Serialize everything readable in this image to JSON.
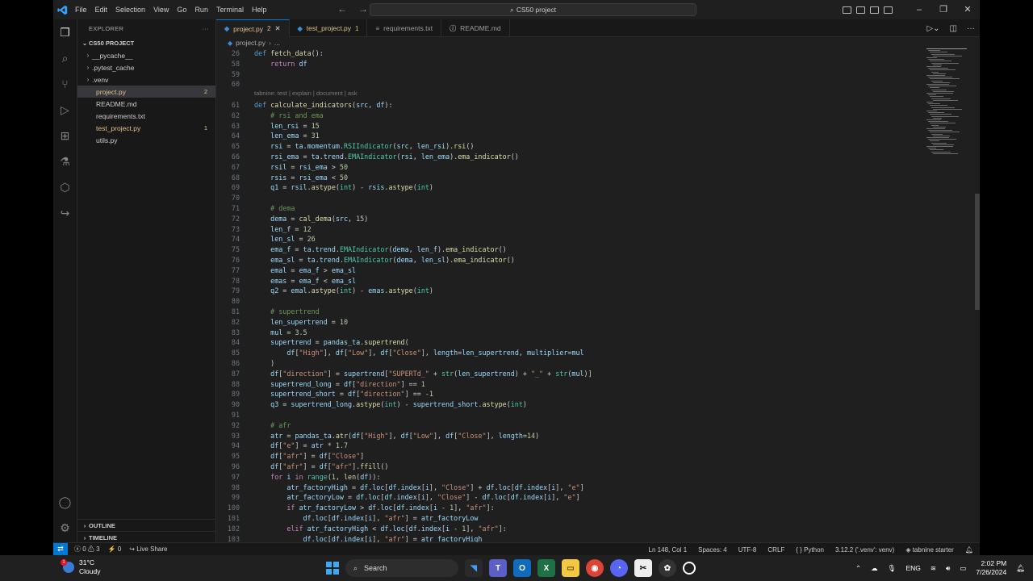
{
  "menu": [
    "File",
    "Edit",
    "Selection",
    "View",
    "Go",
    "Run",
    "Terminal",
    "Help"
  ],
  "search_title": "CS50 project",
  "explorer": {
    "header": "EXPLORER",
    "project": "CS50 PROJECT",
    "items": [
      {
        "label": "__pycache__",
        "folder": true
      },
      {
        "label": ".pytest_cache",
        "folder": true
      },
      {
        "label": ".venv",
        "folder": true
      },
      {
        "label": "project.py",
        "badge": "2",
        "selected": true
      },
      {
        "label": "README.md"
      },
      {
        "label": "requirements.txt"
      },
      {
        "label": "test_project.py",
        "badge": "1"
      },
      {
        "label": "utils.py"
      }
    ],
    "outline": "OUTLINE",
    "timeline": "TIMELINE"
  },
  "tabs": [
    {
      "label": "project.py",
      "mark": "2",
      "active": true
    },
    {
      "label": "test_project.py",
      "mark": "1"
    },
    {
      "label": "requirements.txt",
      "mark": ""
    },
    {
      "label": "README.md",
      "mark": ""
    }
  ],
  "breadcrumb": [
    "project.py",
    "..."
  ],
  "codelens": "tabnine: test | explain | document | ask",
  "code_lines": [
    {
      "n": "26",
      "html": "<span class=\"kw\">def</span> <span class=\"fn\">fetch_data</span>():"
    },
    {
      "n": "58",
      "html": "    <span class=\"cf\">return</span> <span class=\"vr\">df</span>"
    },
    {
      "n": "59",
      "html": ""
    },
    {
      "n": "60",
      "html": ""
    },
    {
      "n": "61",
      "html": "<span class=\"kw\">def</span> <span class=\"fn\">calculate_indicators</span>(<span class=\"pm\">src</span>, <span class=\"pm\">df</span>):"
    },
    {
      "n": "62",
      "html": "    <span class=\"cm\"># rsi and ema</span>"
    },
    {
      "n": "63",
      "html": "    <span class=\"vr\">len_rsi</span> = <span class=\"nm\">15</span>"
    },
    {
      "n": "64",
      "html": "    <span class=\"vr\">len_ema</span> = <span class=\"nm\">31</span>"
    },
    {
      "n": "65",
      "html": "    <span class=\"vr\">rsi</span> = <span class=\"vr\">ta</span>.<span class=\"vr\">momentum</span>.<span class=\"bi\">RSIIndicator</span>(<span class=\"vr\">src</span>, <span class=\"vr\">len_rsi</span>).<span class=\"fn\">rsi</span>()"
    },
    {
      "n": "66",
      "html": "    <span class=\"vr\">rsi_ema</span> = <span class=\"vr\">ta</span>.<span class=\"vr\">trend</span>.<span class=\"bi\">EMAIndicator</span>(<span class=\"vr\">rsi</span>, <span class=\"vr\">len_ema</span>).<span class=\"fn\">ema_indicator</span>()"
    },
    {
      "n": "67",
      "html": "    <span class=\"vr\">rsil</span> = <span class=\"vr\">rsi_ema</span> &gt; <span class=\"nm\">50</span>"
    },
    {
      "n": "68",
      "html": "    <span class=\"vr\">rsis</span> = <span class=\"vr\">rsi_ema</span> &lt; <span class=\"nm\">50</span>"
    },
    {
      "n": "69",
      "html": "    <span class=\"vr\">q1</span> = <span class=\"vr\">rsil</span>.<span class=\"fn\">astype</span>(<span class=\"bi\">int</span>) - <span class=\"vr\">rsis</span>.<span class=\"fn\">astype</span>(<span class=\"bi\">int</span>)"
    },
    {
      "n": "70",
      "html": ""
    },
    {
      "n": "71",
      "html": "    <span class=\"cm\"># dema</span>"
    },
    {
      "n": "72",
      "html": "    <span class=\"vr\">dema</span> = <span class=\"fn\">cal_dema</span>(<span class=\"vr\">src</span>, <span class=\"nm\">15</span>)"
    },
    {
      "n": "73",
      "html": "    <span class=\"vr\">len_f</span> = <span class=\"nm\">12</span>"
    },
    {
      "n": "74",
      "html": "    <span class=\"vr\">len_sl</span> = <span class=\"nm\">26</span>"
    },
    {
      "n": "75",
      "html": "    <span class=\"vr\">ema_f</span> = <span class=\"vr\">ta</span>.<span class=\"vr\">trend</span>.<span class=\"bi\">EMAIndicator</span>(<span class=\"vr\">dema</span>, <span class=\"vr\">len_f</span>).<span class=\"fn\">ema_indicator</span>()"
    },
    {
      "n": "76",
      "html": "    <span class=\"vr\">ema_sl</span> = <span class=\"vr\">ta</span>.<span class=\"vr\">trend</span>.<span class=\"bi\">EMAIndicator</span>(<span class=\"vr\">dema</span>, <span class=\"vr\">len_sl</span>).<span class=\"fn\">ema_indicator</span>()"
    },
    {
      "n": "77",
      "html": "    <span class=\"vr\">emal</span> = <span class=\"vr\">ema_f</span> &gt; <span class=\"vr\">ema_sl</span>"
    },
    {
      "n": "78",
      "html": "    <span class=\"vr\">emas</span> = <span class=\"vr\">ema_f</span> &lt; <span class=\"vr\">ema_sl</span>"
    },
    {
      "n": "79",
      "html": "    <span class=\"vr\">q2</span> = <span class=\"vr\">emal</span>.<span class=\"fn\">astype</span>(<span class=\"bi\">int</span>) - <span class=\"vr\">emas</span>.<span class=\"fn\">astype</span>(<span class=\"bi\">int</span>)"
    },
    {
      "n": "80",
      "html": ""
    },
    {
      "n": "81",
      "html": "    <span class=\"cm\"># supertrend</span>"
    },
    {
      "n": "82",
      "html": "    <span class=\"vr\">len_supertrend</span> = <span class=\"nm\">10</span>"
    },
    {
      "n": "83",
      "html": "    <span class=\"vr\">mul</span> = <span class=\"nm\">3.5</span>"
    },
    {
      "n": "84",
      "html": "    <span class=\"vr\">supertrend</span> = <span class=\"vr\">pandas_ta</span>.<span class=\"fn\">supertrend</span>("
    },
    {
      "n": "85",
      "html": "        <span class=\"vr\">df</span>[<span class=\"st\">\"High\"</span>], <span class=\"vr\">df</span>[<span class=\"st\">\"Low\"</span>], <span class=\"vr\">df</span>[<span class=\"st\">\"Close\"</span>], <span class=\"pm\">length</span>=<span class=\"vr\">len_supertrend</span>, <span class=\"pm\">multiplier</span>=<span class=\"vr\">mul</span>"
    },
    {
      "n": "86",
      "html": "    )"
    },
    {
      "n": "87",
      "html": "    <span class=\"vr\">df</span>[<span class=\"st\">\"direction\"</span>] = <span class=\"vr\">supertrend</span>[<span class=\"st\">\"SUPERTd_\"</span> + <span class=\"bi\">str</span>(<span class=\"vr\">len_supertrend</span>) + <span class=\"st\">\"_\"</span> + <span class=\"bi\">str</span>(<span class=\"vr\">mul</span>)]"
    },
    {
      "n": "88",
      "html": "    <span class=\"vr\">supertrend_long</span> = <span class=\"vr\">df</span>[<span class=\"st\">\"direction\"</span>] == <span class=\"nm\">1</span>"
    },
    {
      "n": "89",
      "html": "    <span class=\"vr\">supertrend_short</span> = <span class=\"vr\">df</span>[<span class=\"st\">\"direction\"</span>] == -<span class=\"nm\">1</span>"
    },
    {
      "n": "90",
      "html": "    <span class=\"vr\">q3</span> = <span class=\"vr\">supertrend_long</span>.<span class=\"fn\">astype</span>(<span class=\"bi\">int</span>) - <span class=\"vr\">supertrend_short</span>.<span class=\"fn\">astype</span>(<span class=\"bi\">int</span>)"
    },
    {
      "n": "91",
      "html": ""
    },
    {
      "n": "92",
      "html": "    <span class=\"cm\"># afr</span>"
    },
    {
      "n": "93",
      "html": "    <span class=\"vr\">atr</span> = <span class=\"vr\">pandas_ta</span>.<span class=\"fn\">atr</span>(<span class=\"vr\">df</span>[<span class=\"st\">\"High\"</span>], <span class=\"vr\">df</span>[<span class=\"st\">\"Low\"</span>], <span class=\"vr\">df</span>[<span class=\"st\">\"Close\"</span>], <span class=\"pm\">length</span>=<span class=\"nm\">14</span>)"
    },
    {
      "n": "94",
      "html": "    <span class=\"vr\">df</span>[<span class=\"st\">\"e\"</span>] = <span class=\"vr\">atr</span> * <span class=\"nm\">1.7</span>"
    },
    {
      "n": "95",
      "html": "    <span class=\"vr\">df</span>[<span class=\"st\">\"afr\"</span>] = <span class=\"vr\">df</span>[<span class=\"st\">\"Close\"</span>]"
    },
    {
      "n": "96",
      "html": "    <span class=\"vr\">df</span>[<span class=\"st\">\"afr\"</span>] = <span class=\"vr\">df</span>[<span class=\"st\">\"afr\"</span>].<span class=\"fn\">ffill</span>()"
    },
    {
      "n": "97",
      "html": "    <span class=\"cf\">for</span> <span class=\"vr\">i</span> <span class=\"cf\">in</span> <span class=\"bi\">range</span>(<span class=\"nm\">1</span>, <span class=\"fn\">len</span>(<span class=\"vr\">df</span>)):"
    },
    {
      "n": "98",
      "html": "        <span class=\"vr\">atr_factoryHigh</span> = <span class=\"vr\">df</span>.<span class=\"vr\">loc</span>[<span class=\"vr\">df</span>.<span class=\"vr\">index</span>[<span class=\"vr\">i</span>], <span class=\"st\">\"Close\"</span>] + <span class=\"vr\">df</span>.<span class=\"vr\">loc</span>[<span class=\"vr\">df</span>.<span class=\"vr\">index</span>[<span class=\"vr\">i</span>], <span class=\"st\">\"e\"</span>]"
    },
    {
      "n": "99",
      "html": "        <span class=\"vr\">atr_factoryLow</span> = <span class=\"vr\">df</span>.<span class=\"vr\">loc</span>[<span class=\"vr\">df</span>.<span class=\"vr\">index</span>[<span class=\"vr\">i</span>], <span class=\"st\">\"Close\"</span>] - <span class=\"vr\">df</span>.<span class=\"vr\">loc</span>[<span class=\"vr\">df</span>.<span class=\"vr\">index</span>[<span class=\"vr\">i</span>], <span class=\"st\">\"e\"</span>]"
    },
    {
      "n": "100",
      "html": "        <span class=\"cf\">if</span> <span class=\"vr\">atr_factoryLow</span> &gt; <span class=\"vr\">df</span>.<span class=\"vr\">loc</span>[<span class=\"vr\">df</span>.<span class=\"vr\">index</span>[<span class=\"vr\">i</span> - <span class=\"nm\">1</span>], <span class=\"st\">\"afr\"</span>]:"
    },
    {
      "n": "101",
      "html": "            <span class=\"vr\">df</span>.<span class=\"vr\">loc</span>[<span class=\"vr\">df</span>.<span class=\"vr\">index</span>[<span class=\"vr\">i</span>], <span class=\"st\">\"afr\"</span>] = <span class=\"vr\">atr_factoryLow</span>"
    },
    {
      "n": "102",
      "html": "        <span class=\"cf\">elif</span> <span class=\"vr\">atr_factoryHigh</span> &lt; <span class=\"vr\">df</span>.<span class=\"vr\">loc</span>[<span class=\"vr\">df</span>.<span class=\"vr\">index</span>[<span class=\"vr\">i</span> - <span class=\"nm\">1</span>], <span class=\"st\">\"afr\"</span>]:"
    },
    {
      "n": "103",
      "html": "            <span class=\"vr\">df</span>.<span class=\"vr\">loc</span>[<span class=\"vr\">df</span>.<span class=\"vr\">index</span>[<span class=\"vr\">i</span>], <span class=\"st\">\"afr\"</span>] = <span class=\"vr\">atr_factoryHigh</span>"
    }
  ],
  "status": {
    "errors": "0",
    "warnings": "3",
    "ports": "0",
    "live_share": "Live Share",
    "position": "Ln 148, Col 1",
    "spaces": "Spaces: 4",
    "encoding": "UTF-8",
    "eol": "CRLF",
    "language": "Python",
    "interpreter": "3.12.2 ('.venv': venv)",
    "tabnine": "tabnine starter"
  },
  "taskbar": {
    "temp": "31°C",
    "weather": "Cloudy",
    "weather_badge": "1",
    "search": "Search",
    "lang": "ENG",
    "time": "2:02 PM",
    "date": "7/26/2024"
  }
}
